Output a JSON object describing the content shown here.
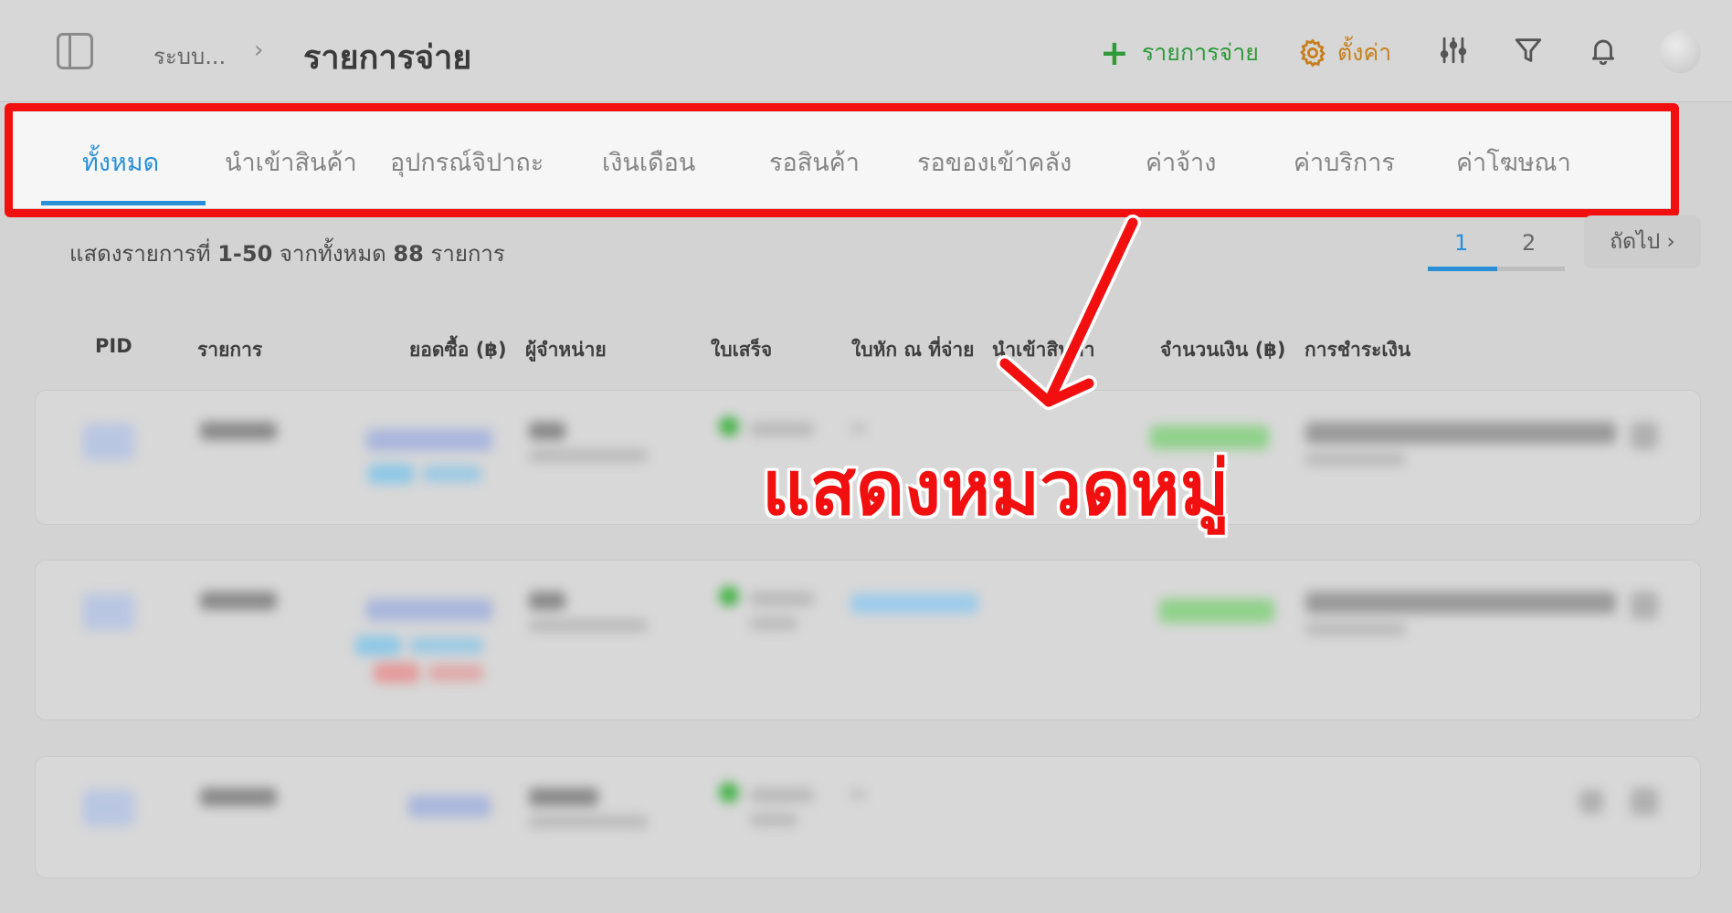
{
  "header": {
    "breadcrumb_root": "ระบบ...",
    "breadcrumb_separator": "›",
    "title": "รายการจ่าย",
    "add_label": "รายการจ่าย",
    "settings_label": "ตั้งค่า"
  },
  "tabs": [
    {
      "label": "ทั้งหมด",
      "active": true
    },
    {
      "label": "นำเข้าสินค้า"
    },
    {
      "label": "อุปกรณ์จิปาถะ"
    },
    {
      "label": "เงินเดือน"
    },
    {
      "label": "รอสินค้า"
    },
    {
      "label": "รอของเข้าคลัง"
    },
    {
      "label": "ค่าจ้าง"
    },
    {
      "label": "ค่าบริการ"
    },
    {
      "label": "ค่าโฆษณา"
    }
  ],
  "summary": {
    "prefix": "แสดงรายการที่",
    "range": "1-50",
    "middle": "จากทั้งหมด",
    "total": "88",
    "suffix": "รายการ"
  },
  "pagination": {
    "pages": [
      "1",
      "2"
    ],
    "current": "1",
    "next_label": "ถัดไป ›"
  },
  "table": {
    "columns": [
      "PID",
      "รายการ",
      "ยอดซื้อ (฿)",
      "ผู้จำหน่าย",
      "ใบเสร็จ",
      "ใบหัก ณ ที่จ่าย",
      "นำเข้าสินค้า",
      "จำนวนเงิน (฿)",
      "การชำระเงิน"
    ]
  },
  "annotation": {
    "text": "แสดงหมวดหมู่",
    "color": "#f20f0f"
  },
  "colors": {
    "accent": "#2a8fd6",
    "add_green": "#2e9a3a",
    "settings_orange": "#c77f1c"
  }
}
